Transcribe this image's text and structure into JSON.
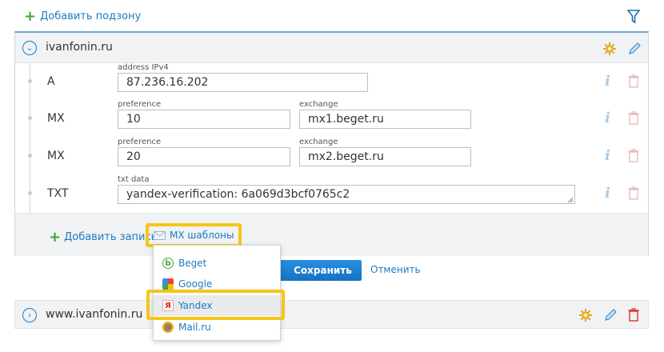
{
  "toolbar": {
    "add_subzone_label": "Добавить подзону"
  },
  "zone": {
    "name": "ivanfonin.ru",
    "records": [
      {
        "type": "A",
        "fields": [
          {
            "label": "address IPv4",
            "value": "87.236.16.202"
          }
        ]
      },
      {
        "type": "MX",
        "fields": [
          {
            "label": "preference",
            "value": "10"
          },
          {
            "label": "exchange",
            "value": "mx1.beget.ru"
          }
        ]
      },
      {
        "type": "MX",
        "fields": [
          {
            "label": "preference",
            "value": "20"
          },
          {
            "label": "exchange",
            "value": "mx2.beget.ru"
          }
        ]
      },
      {
        "type": "TXT",
        "fields": [
          {
            "label": "txt data",
            "value": "yandex-verification: 6a069d3bcf0765c2"
          }
        ]
      }
    ],
    "add_record_label": "Добавить запись",
    "mx_templates_label": "MX шаблоны"
  },
  "actions": {
    "save_label": "Сохранить",
    "cancel_label": "Отменить"
  },
  "mx_dropdown": {
    "items": [
      {
        "label": "Beget",
        "icon": "beget-logo-icon"
      },
      {
        "label": "Google",
        "icon": "google-logo-icon"
      },
      {
        "label": "Yandex",
        "icon": "yandex-logo-icon"
      },
      {
        "label": "Mail.ru",
        "icon": "mailru-logo-icon"
      }
    ]
  },
  "zone2": {
    "name": "www.ivanfonin.ru"
  },
  "colors": {
    "accent": "#1b7bc4",
    "highlight": "#f5c518",
    "plus": "#3aa935",
    "save_button": "#1b7fd0"
  }
}
